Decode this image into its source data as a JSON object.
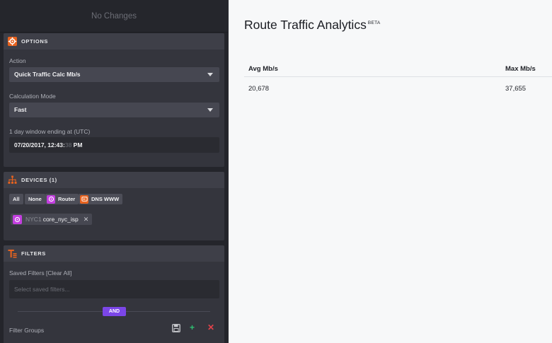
{
  "sidebar": {
    "status": "No Changes",
    "options": {
      "title": "OPTIONS",
      "action_label": "Action",
      "action_value": "Quick Traffic Calc Mb/s",
      "mode_label": "Calculation Mode",
      "mode_value": "Fast",
      "window_label": "1 day window ending at (UTC)",
      "window_date": "07/20/2017, 12:43:",
      "window_seconds": "38",
      "window_ampm": " PM"
    },
    "devices": {
      "title": "DEVICES (1)",
      "chips": [
        {
          "label": "All"
        },
        {
          "label": "None"
        },
        {
          "label": "Router",
          "icon": "router-icon",
          "color": "#c43fe0"
        },
        {
          "label": "DNS WWW",
          "icon": "dns-icon",
          "color": "#e8631f"
        }
      ],
      "selected": {
        "prefix": "NYC1",
        "value": "core_nyc_isp",
        "color": "#c43fe0"
      }
    },
    "filters": {
      "title": "FILTERS",
      "saved_label": "Saved Filters [Clear All]",
      "saved_placeholder": "Select saved filters...",
      "and_label": "AND",
      "groups_label": "Filter Groups"
    }
  },
  "main": {
    "title": "Route Traffic Analytics",
    "title_badge": "BETA",
    "columns": [
      "Avg Mb/s",
      "Max Mb/s"
    ],
    "rows": [
      [
        "20,678",
        "37,655"
      ]
    ]
  },
  "colors": {
    "accent_orange": "#e8631f",
    "and_purple": "#7b46e8",
    "add_green": "#2fbf71",
    "remove_red": "#e2424a"
  }
}
